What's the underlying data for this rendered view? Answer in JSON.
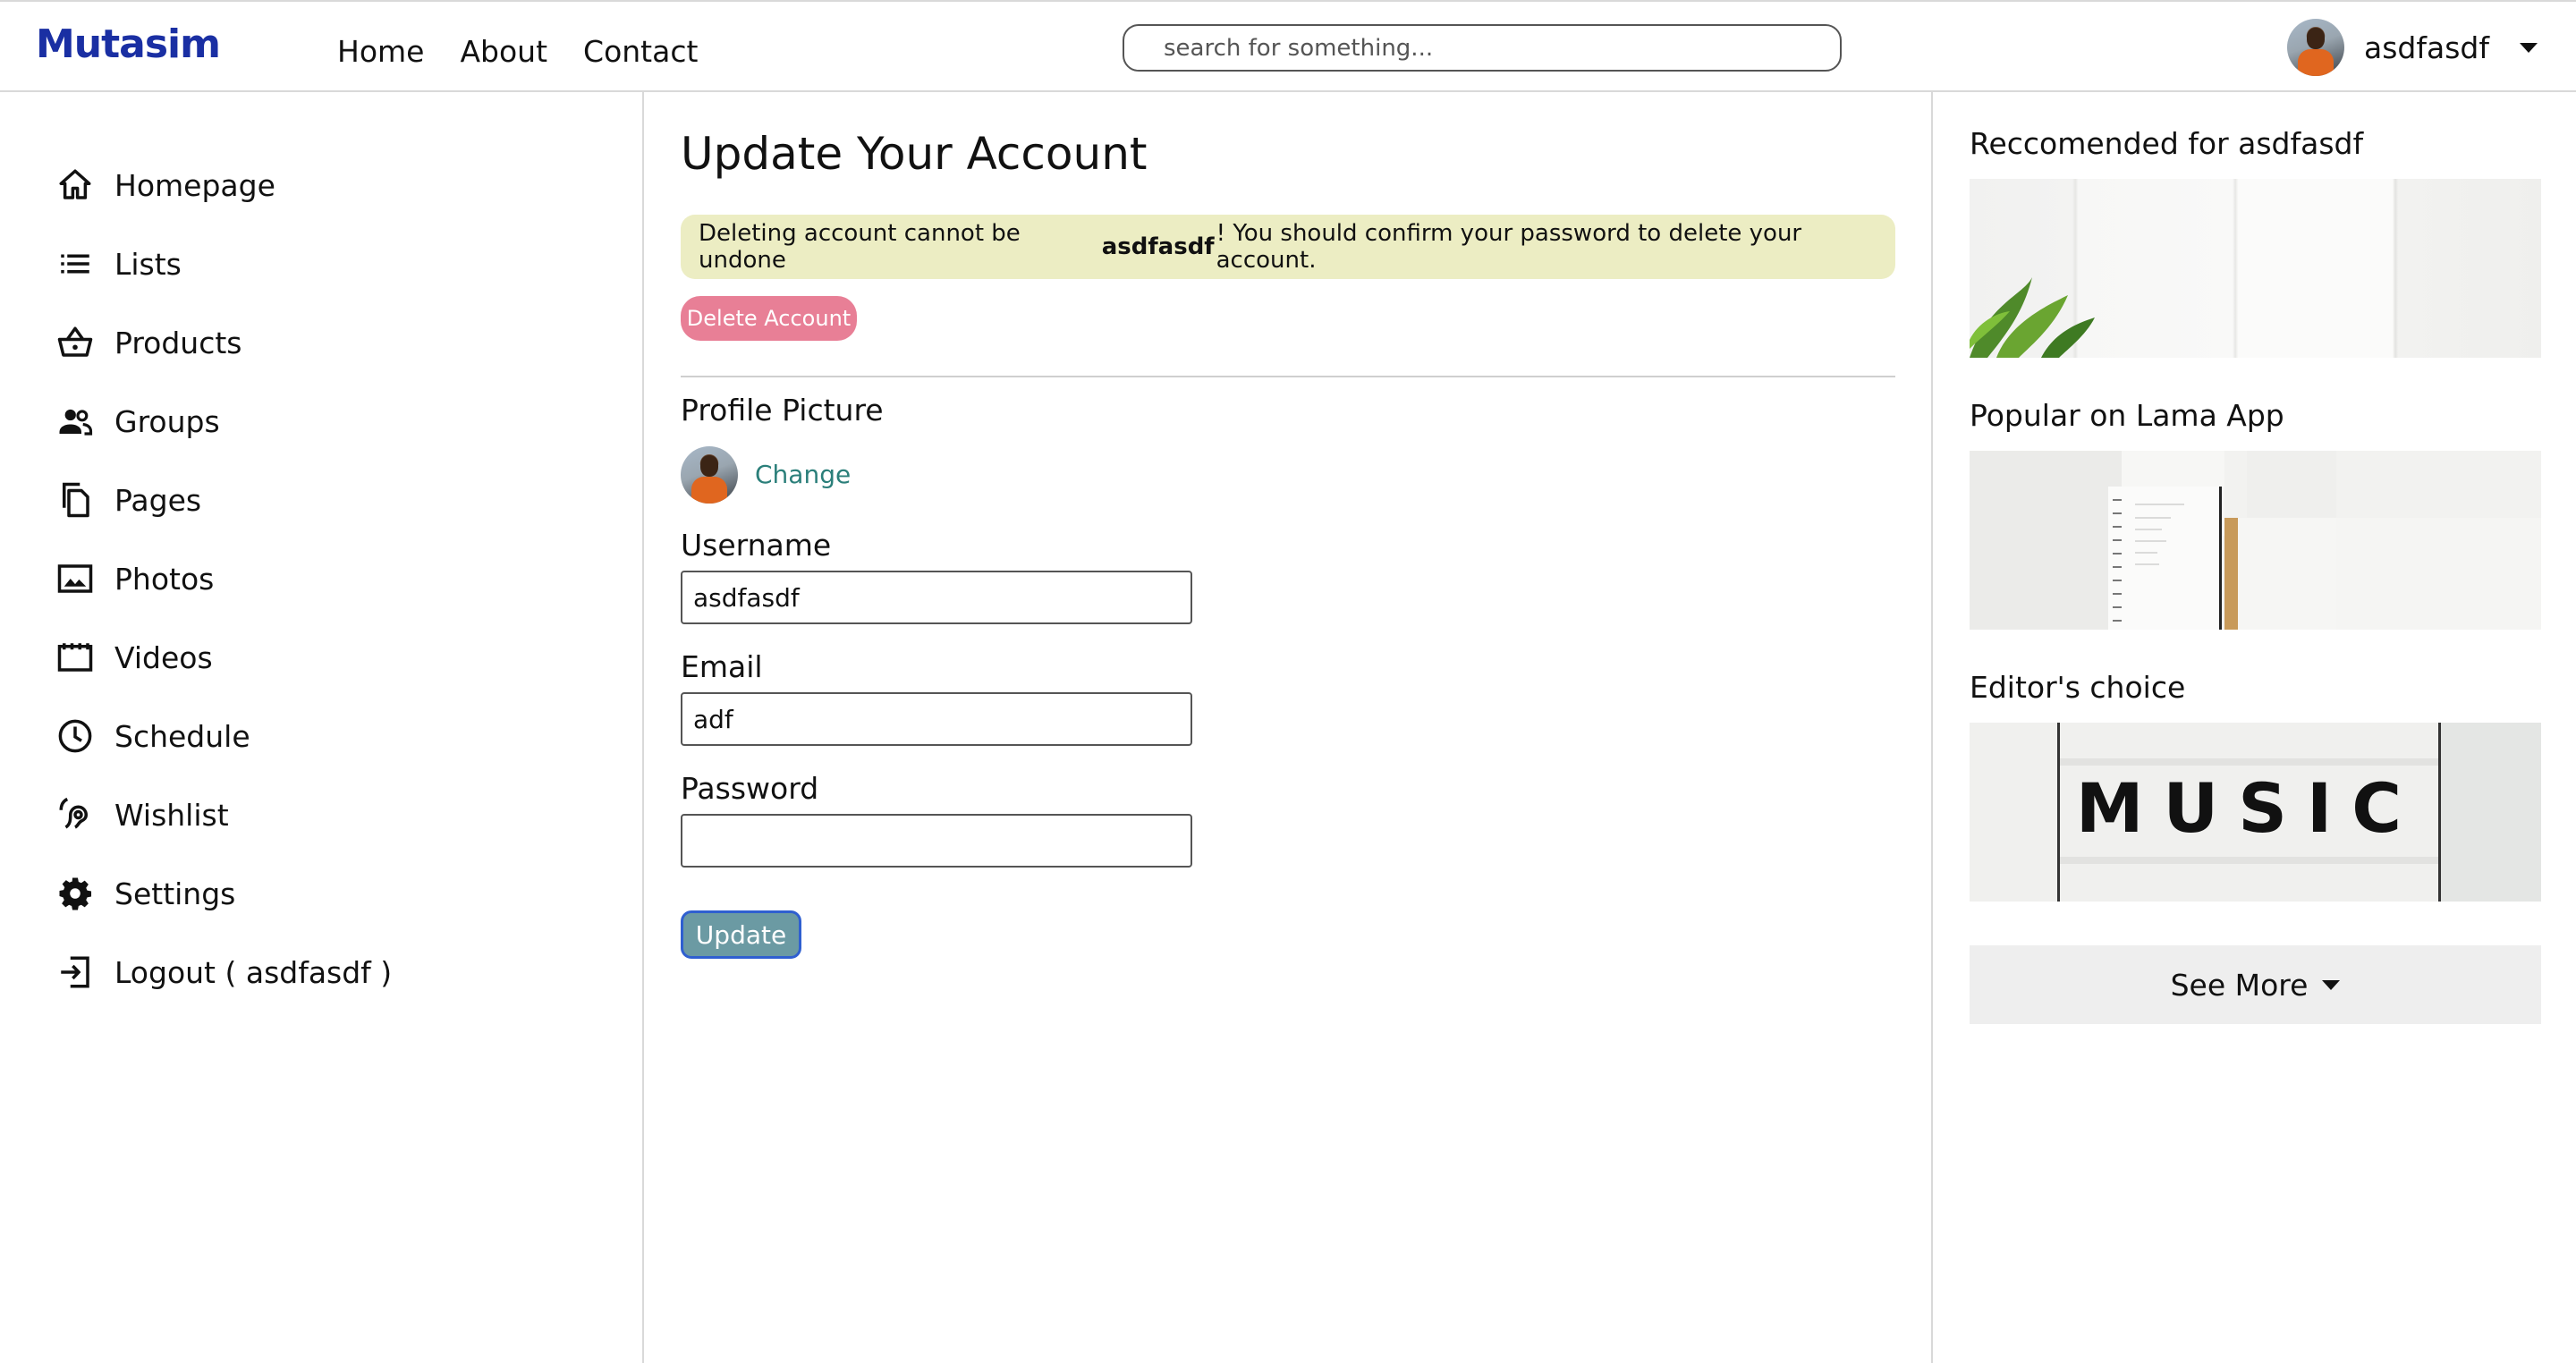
{
  "brand": {
    "logo": "Mutasim"
  },
  "nav": {
    "items": [
      "Home",
      "About",
      "Contact"
    ]
  },
  "search": {
    "placeholder": "search for something..."
  },
  "user": {
    "name": "asdfasdf"
  },
  "sidebar": {
    "items": [
      {
        "label": "Homepage",
        "icon": "home-icon"
      },
      {
        "label": "Lists",
        "icon": "list-icon"
      },
      {
        "label": "Products",
        "icon": "basket-icon"
      },
      {
        "label": "Groups",
        "icon": "group-icon"
      },
      {
        "label": "Pages",
        "icon": "pages-icon"
      },
      {
        "label": "Photos",
        "icon": "photo-icon"
      },
      {
        "label": "Videos",
        "icon": "video-icon"
      },
      {
        "label": "Schedule",
        "icon": "clock-icon"
      },
      {
        "label": "Wishlist",
        "icon": "wishlist-icon"
      },
      {
        "label": "Settings",
        "icon": "gear-icon"
      },
      {
        "label": "Logout ( asdfasdf )",
        "icon": "logout-icon"
      }
    ]
  },
  "main": {
    "title": "Update Your Account",
    "alert": {
      "prefix": "Deleting account cannot be undone",
      "username": "asdfasdf",
      "suffix": "! You should confirm your password to delete your account."
    },
    "delete_label": "Delete Account",
    "profile_picture_label": "Profile Picture",
    "change_label": "Change",
    "username_label": "Username",
    "username_value": "asdfasdf",
    "email_label": "Email",
    "email_value": "adf",
    "password_label": "Password",
    "password_value": "",
    "update_label": "Update"
  },
  "right": {
    "sections": [
      {
        "title": "Reccomended for asdfasdf"
      },
      {
        "title": "Popular on Lama App"
      },
      {
        "title": "Editor's choice",
        "image_text": "MUSIC"
      }
    ],
    "see_more_label": "See More"
  },
  "colors": {
    "brand": "#1a2fa3",
    "alert_bg": "#ecedc3",
    "delete_button": "#e87f96",
    "update_button": "#6b9aa3",
    "link": "#2b7f7a"
  }
}
